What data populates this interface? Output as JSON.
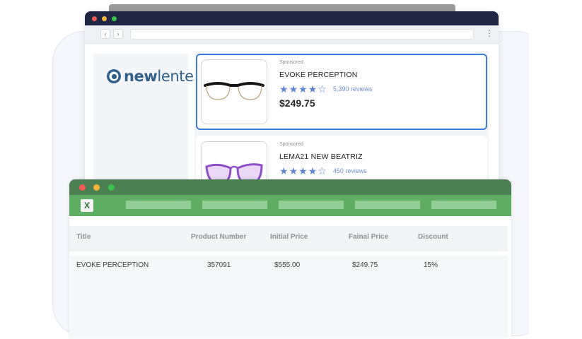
{
  "browser": {
    "nav_back": "‹",
    "nav_forward": "›",
    "menu": "⋮"
  },
  "logo": {
    "part1": "new",
    "part2": "lentes",
    "color": "#2f5f8a"
  },
  "products": [
    {
      "sponsored": "Sponsored",
      "name": "EVOKE PERCEPTION",
      "rating": 4.5,
      "reviews": "5,390 reviews",
      "price": "$249.75",
      "selected": true
    },
    {
      "sponsored": "Sponsored",
      "name": "LEMA21 NEW BEATRIZ",
      "rating": 4.5,
      "reviews": "450 reviews",
      "selected": false
    }
  ],
  "spreadsheet": {
    "app_icon": "X",
    "columns": [
      "Title",
      "Product Number",
      "Initial Price",
      "Fainal Price",
      "Discount"
    ],
    "rows": [
      [
        "EVOKE PERCEPTION",
        "357091",
        "$555.00",
        "$249.75",
        "15%"
      ]
    ]
  },
  "colors": {
    "accent": "#3b7ddd",
    "browser_titlebar": "#1f2644",
    "sheet_titlebar": "#4c7f51",
    "sheet_ribbon": "#5dae63",
    "star": "#5d86d4"
  }
}
